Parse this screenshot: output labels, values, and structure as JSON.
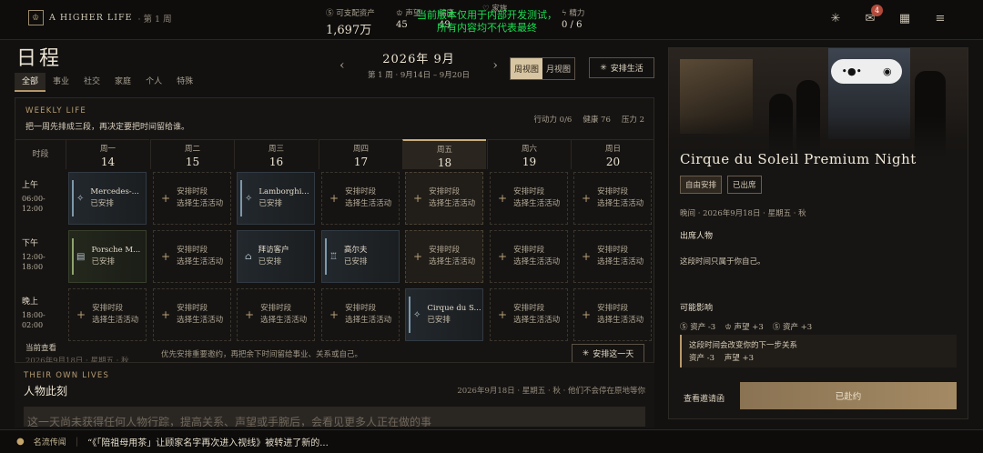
{
  "topbar": {
    "brand_name": "A HIGHER LIFE",
    "week": "· 第 1 周",
    "stats": [
      {
        "label": "⑤ 可支配资产",
        "value": "1,697万"
      },
      {
        "label": "声望",
        "value": "45"
      },
      {
        "label": "健康",
        "value": "49"
      },
      {
        "label": "家族",
        "value": "2"
      },
      {
        "label": "精力",
        "value": "0 / 6"
      }
    ],
    "dev_notice_line1": "当前版本仅用于内部开发测试，",
    "dev_notice_line2": "所有内容均不代表最终",
    "notification_count": "4"
  },
  "page": {
    "title": "日程",
    "categories": [
      "全部",
      "事业",
      "社交",
      "家庭",
      "个人",
      "特殊"
    ]
  },
  "week_nav": {
    "title": "2026年 9月",
    "subtitle": "第 1 周 · 9月14日 – 9月20日",
    "view_week": "周视图",
    "view_month": "月视图",
    "arrange_life": "安排生活"
  },
  "weekly": {
    "label": "WEEKLY LIFE",
    "desc": "把一周先排成三段，再决定要把时间留给谁。",
    "action_points": "行动力 0/6",
    "health": "健康 76",
    "pressure": "压力 2",
    "time_header": "时段",
    "days": [
      {
        "d": "周一",
        "n": "14"
      },
      {
        "d": "周二",
        "n": "15"
      },
      {
        "d": "周三",
        "n": "16"
      },
      {
        "d": "周四",
        "n": "17"
      },
      {
        "d": "周五",
        "n": "18"
      },
      {
        "d": "周六",
        "n": "19"
      },
      {
        "d": "周日",
        "n": "20"
      }
    ],
    "rows": [
      {
        "name": "上午",
        "time": "06:00-\n12:00"
      },
      {
        "name": "下午",
        "time": "12:00-\n18:00"
      },
      {
        "name": "晚上",
        "time": "18:00-\n02:00"
      }
    ],
    "empty_line1": "安排时段",
    "empty_line2": "选择生活活动",
    "scheduled": "已安排",
    "events": {
      "mon_am": "Mercedes-...",
      "wed_am": "Lamborghi...",
      "mon_pm": "Porsche M...",
      "wed_pm": "拜访客户",
      "thu_pm": "高尔夫",
      "fri_ev": "Cirque du S..."
    },
    "current_view": "当前查看",
    "current_date": "2026年9月18日 · 星期五 · 秋",
    "hint": "优先安排重要邀约，再把余下时间留给事业、关系或自己。",
    "arrange_day": "安排这一天"
  },
  "lives": {
    "label": "THEIR OWN LIVES",
    "title": "人物此刻",
    "date": "2026年9月18日 · 星期五 · 秋 · 他们不会停在原地等你",
    "fade_text": "这一天尚未获得任何人物行踪，提高关系、声望或手腕后，会看见更多人正在做的事"
  },
  "ticker": {
    "label": "名流传闻",
    "text": "“《「陪祖母用茶」让顾家名字再次进入视线》被转进了新的..."
  },
  "side": {
    "event_title": "Cirque du Soleil Premium Night",
    "tag_free": "自由安排",
    "tag_attended": "已出席",
    "when": "晚间 · 2026年9月18日 · 星期五 · 秋",
    "attendees_label": "出席人物",
    "attendees_text": "这段时间只属于你自己。",
    "impact_label": "可能影响",
    "impacts": [
      "⑤ 资产 -3",
      "♔ 声望 +3",
      "⑤ 资产 +3"
    ],
    "note_line1": "这段时间会改变你的下一步关系",
    "note_line2": "资产 -3    声望 +3",
    "view_invite": "查看邀请函",
    "attended_btn": "已赴约"
  }
}
